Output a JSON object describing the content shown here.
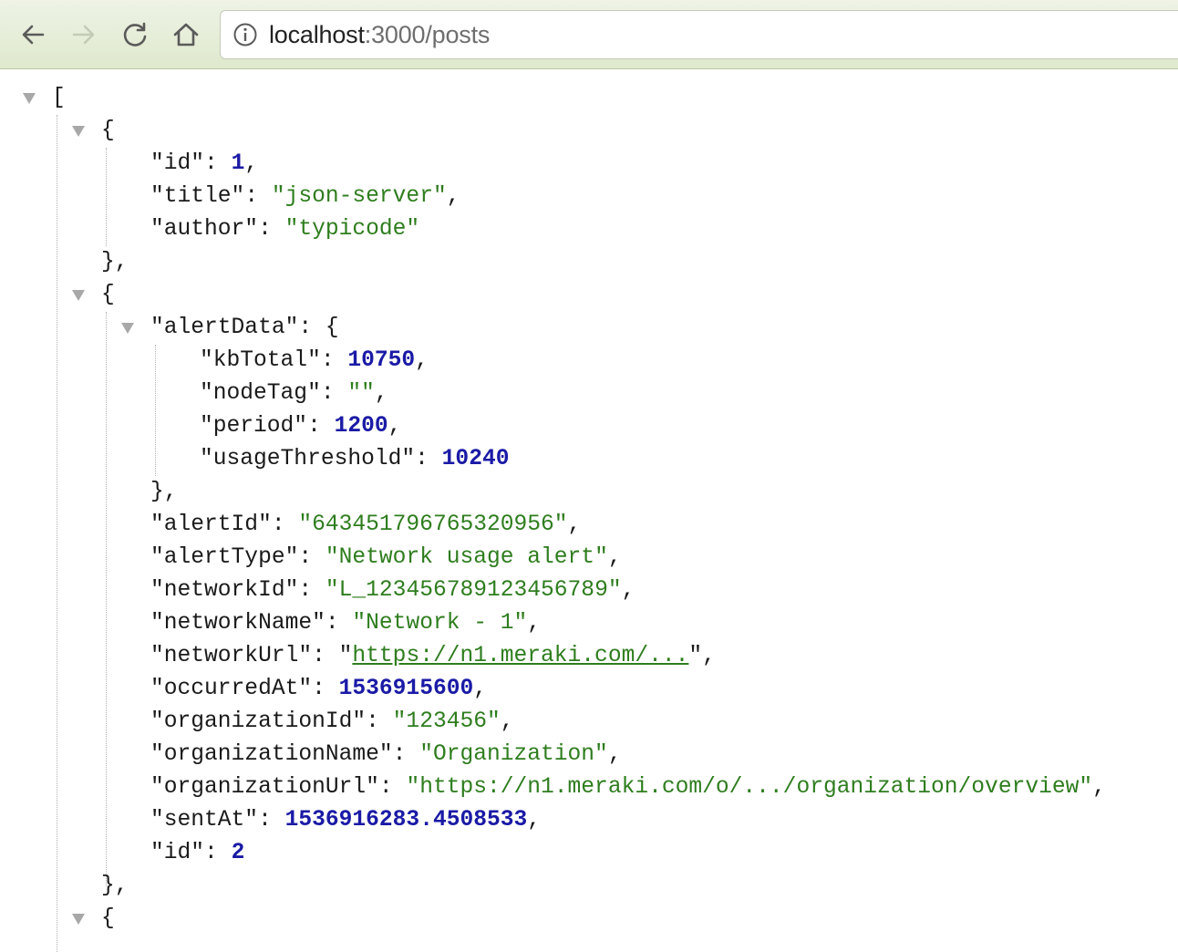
{
  "browser": {
    "url_host": "localhost",
    "url_port_path": ":3000/posts",
    "icons": {
      "back": "back-arrow-icon",
      "forward": "forward-arrow-icon",
      "reload": "reload-icon",
      "home": "home-icon",
      "info": "info-icon"
    }
  },
  "json": {
    "open_bracket": "[",
    "open_brace": "{",
    "close_brace_comma": "},",
    "posts": [
      {
        "fields": [
          {
            "key": "\"id\"",
            "value": "1",
            "type": "number",
            "comma": true
          },
          {
            "key": "\"title\"",
            "value": "\"json-server\"",
            "type": "string",
            "comma": true
          },
          {
            "key": "\"author\"",
            "value": "\"typicode\"",
            "type": "string",
            "comma": false
          }
        ]
      },
      {
        "alertData": {
          "key": "\"alertData\"",
          "fields": [
            {
              "key": "\"kbTotal\"",
              "value": "10750",
              "type": "number",
              "comma": true
            },
            {
              "key": "\"nodeTag\"",
              "value": "\"\"",
              "type": "string",
              "comma": true
            },
            {
              "key": "\"period\"",
              "value": "1200",
              "type": "number",
              "comma": true
            },
            {
              "key": "\"usageThreshold\"",
              "value": "10240",
              "type": "number",
              "comma": false
            }
          ]
        },
        "fields": [
          {
            "key": "\"alertId\"",
            "value": "\"643451796765320956\"",
            "type": "string",
            "comma": true
          },
          {
            "key": "\"alertType\"",
            "value": "\"Network usage alert\"",
            "type": "string",
            "comma": true
          },
          {
            "key": "\"networkId\"",
            "value": "\"L_123456789123456789\"",
            "type": "string",
            "comma": true
          },
          {
            "key": "\"networkName\"",
            "value": "\"Network - 1\"",
            "type": "string",
            "comma": true
          },
          {
            "key": "\"networkUrl\"",
            "value": "https://n1.meraki.com/...",
            "type": "link",
            "comma": true
          },
          {
            "key": "\"occurredAt\"",
            "value": "1536915600",
            "type": "number",
            "comma": true
          },
          {
            "key": "\"organizationId\"",
            "value": "\"123456\"",
            "type": "string",
            "comma": true
          },
          {
            "key": "\"organizationName\"",
            "value": "\"Organization\"",
            "type": "string",
            "comma": true
          },
          {
            "key": "\"organizationUrl\"",
            "value": "\"https://n1.meraki.com/o/.../organization/overview\"",
            "type": "string",
            "comma": true
          },
          {
            "key": "\"sentAt\"",
            "value": "1536916283.4508533",
            "type": "number",
            "comma": true
          },
          {
            "key": "\"id\"",
            "value": "2",
            "type": "number",
            "comma": false
          }
        ]
      }
    ]
  }
}
